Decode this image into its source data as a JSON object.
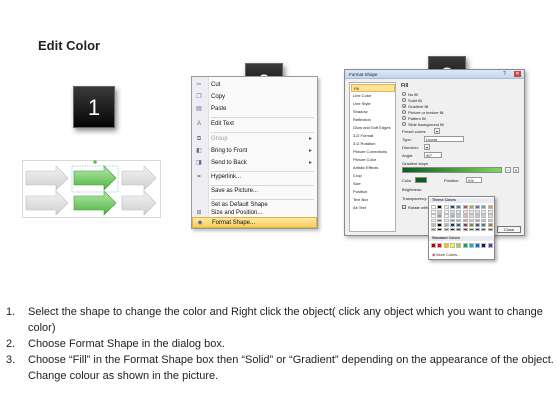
{
  "page": {
    "title": "Edit Color"
  },
  "badges": [
    "1",
    "2",
    "3"
  ],
  "context_menu": {
    "items": [
      {
        "label": "Cut",
        "icon": "scissors-icon",
        "enabled": true
      },
      {
        "label": "Copy",
        "icon": "copy-icon",
        "enabled": true
      },
      {
        "label": "Paste",
        "icon": "paste-icon",
        "enabled": true
      },
      {
        "label": "Edit Text",
        "icon": "edit-text-icon",
        "enabled": true
      },
      {
        "label": "Group",
        "icon": "group-icon",
        "enabled": false,
        "submenu": true
      },
      {
        "label": "Bring to Front",
        "icon": "bring-to-front-icon",
        "enabled": true,
        "submenu": true
      },
      {
        "label": "Send to Back",
        "icon": "send-to-back-icon",
        "enabled": true,
        "submenu": true
      },
      {
        "label": "Hyperlink...",
        "icon": "hyperlink-icon",
        "enabled": true
      },
      {
        "label": "Save as Picture...",
        "icon": "",
        "enabled": true
      },
      {
        "label": "Set as Default Shape",
        "icon": "",
        "enabled": true
      },
      {
        "label": "Size and Position...",
        "icon": "size-position-icon",
        "enabled": true
      },
      {
        "label": "Format Shape...",
        "icon": "format-shape-icon",
        "enabled": true,
        "highlighted": true
      }
    ],
    "submenu_glyph": "▸"
  },
  "format_dialog": {
    "title": "Format Shape",
    "categories": [
      "Fill",
      "Line Color",
      "Line Style",
      "Shadow",
      "Reflection",
      "Glow and Soft Edges",
      "3-D Format",
      "3-D Rotation",
      "Picture Corrections",
      "Picture Color",
      "Artistic Effects",
      "Crop",
      "Size",
      "Position",
      "Text Box",
      "Alt Text"
    ],
    "section_title": "Fill",
    "fill_options": [
      "No fill",
      "Solid fill",
      "Gradient fill",
      "Picture or texture fill",
      "Pattern fill",
      "Slide background fill"
    ],
    "selected_fill": "Gradient fill",
    "preset_label": "Preset colors:",
    "type_label": "Type:",
    "type_value": "Linear",
    "direction_label": "Direction:",
    "angle_label": "Angle:",
    "angle_value": "90°",
    "stops_label": "Gradient stops",
    "color_label": "Color",
    "position_label": "Position:",
    "position_value": "0%",
    "brightness_label": "Brightness:",
    "transparency_label": "Transparency:",
    "rotate_label": "Rotate with shape",
    "close_label": "Close",
    "gradient_colors": [
      "#0b5d1e",
      "#7ed957"
    ]
  },
  "color_popup": {
    "theme_header": "Theme Colors",
    "standard_header": "Standard Colors",
    "more_colors": "More Colors...",
    "theme_top": [
      "#ffffff",
      "#000000",
      "#eeece1",
      "#1f497d",
      "#4f81bd",
      "#c0504d",
      "#9bbb59",
      "#8064a2",
      "#4bacc6",
      "#f79646"
    ],
    "standard": [
      "#c00000",
      "#ff0000",
      "#ffc000",
      "#ffff00",
      "#92d050",
      "#00b050",
      "#00b0f0",
      "#0070c0",
      "#002060",
      "#7030a0"
    ]
  },
  "instructions": [
    {
      "num": "1.",
      "text": "Select the shape to change the color and Right click the object( click any object which you want to change color)"
    },
    {
      "num": "2.",
      "text": "Choose Format Shape in the dialog box."
    },
    {
      "num": "3.",
      "text": "Choose “Fill” in the Format Shape box then “Solid” or “Gradient” depending on the appearance of the object. Change colour as shown in the picture."
    }
  ],
  "colors": {
    "badge": "#111111",
    "highlight": "#f8cd5a",
    "accent_green": "#5cc64a"
  }
}
